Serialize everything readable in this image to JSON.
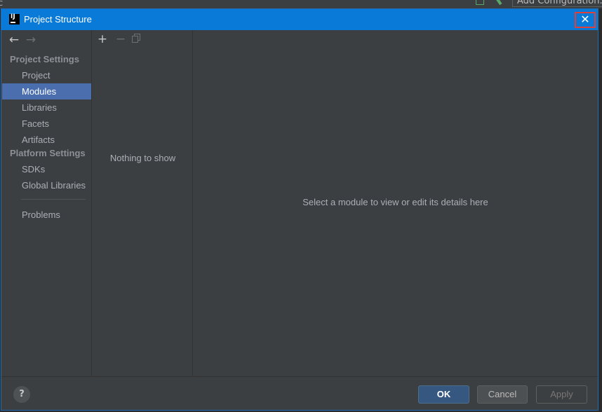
{
  "ide": {
    "left_glyph": "C",
    "config_label": "Add Configuration..."
  },
  "dialog": {
    "title": "Project Structure",
    "close_glyph": "✕"
  },
  "sidebar": {
    "back_glyph": "←",
    "forward_glyph": "→",
    "project_settings_heading": "Project Settings",
    "project_items": [
      {
        "label": "Project",
        "selected": false
      },
      {
        "label": "Modules",
        "selected": true
      },
      {
        "label": "Libraries",
        "selected": false
      },
      {
        "label": "Facets",
        "selected": false
      },
      {
        "label": "Artifacts",
        "selected": false
      }
    ],
    "platform_settings_heading": "Platform Settings",
    "platform_items": [
      {
        "label": "SDKs"
      },
      {
        "label": "Global Libraries"
      }
    ],
    "problems_label": "Problems"
  },
  "list_panel": {
    "add_glyph": "+",
    "remove_glyph": "−",
    "empty_text": "Nothing to show"
  },
  "detail_panel": {
    "hint": "Select a module to view or edit its details here"
  },
  "footer": {
    "help_glyph": "?",
    "ok_label": "OK",
    "cancel_label": "Cancel",
    "apply_label": "Apply"
  },
  "colors": {
    "titlebar": "#0a7ad8",
    "selection": "#4b6eaf",
    "panel": "#3c3f41",
    "close_highlight": "#e0403a"
  }
}
